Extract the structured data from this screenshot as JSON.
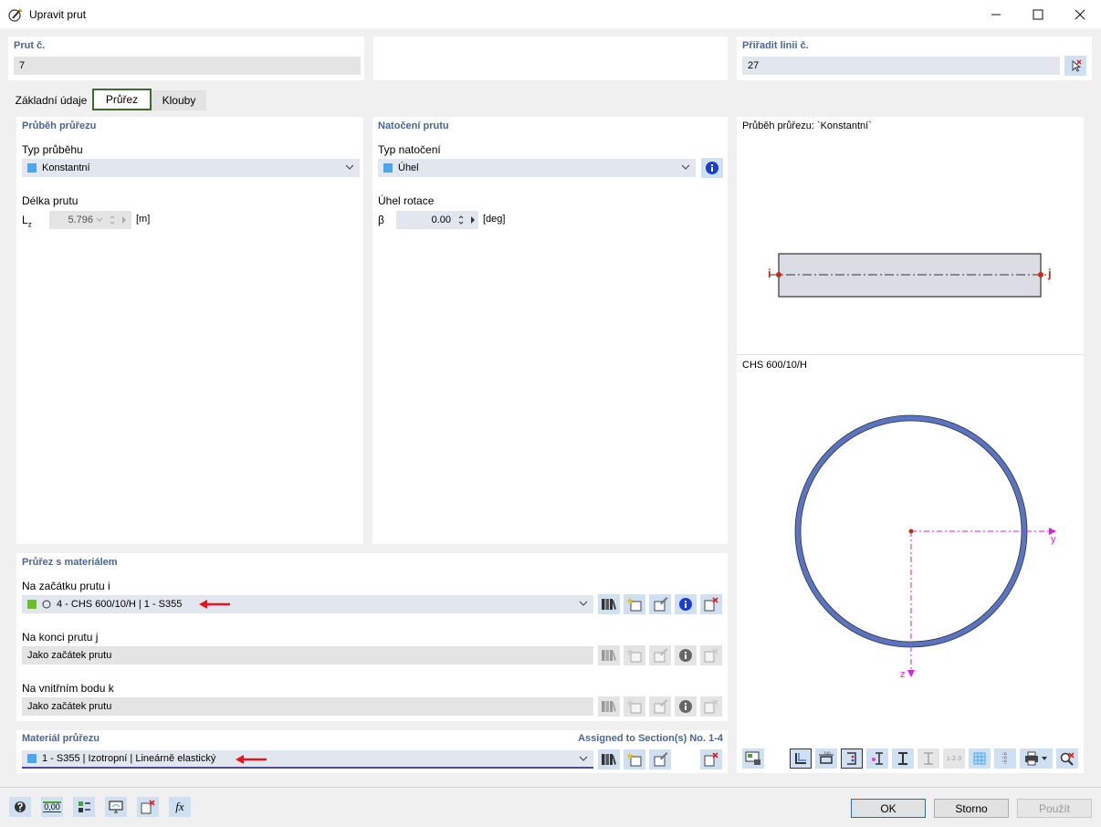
{
  "window": {
    "title": "Upravit prut"
  },
  "header": {
    "member_label": "Prut č.",
    "member_value": "7",
    "line_label": "Přiřadit linii č.",
    "line_value": "27"
  },
  "tabs": [
    {
      "label": "Základní údaje"
    },
    {
      "label": "Průřez"
    },
    {
      "label": "Klouby"
    }
  ],
  "section_variation": {
    "title": "Průběh průřezu",
    "type_label": "Typ průběhu",
    "type_value": "Konstantní",
    "length_label": "Délka prutu",
    "length_symbol": "L",
    "length_subscript": "z",
    "length_value": "5.796",
    "length_unit": "[m]"
  },
  "rotation": {
    "title": "Natočení prutu",
    "type_label": "Typ natočení",
    "type_value": "Úhel",
    "angle_label": "Úhel rotace",
    "angle_symbol": "β",
    "angle_value": "0.00",
    "angle_unit": "[deg]"
  },
  "section_material": {
    "title": "Průřez s materiálem",
    "start_label": "Na začátku prutu i",
    "start_value": "4 - CHS 600/10/H | 1 - S355",
    "end_label": "Na konci prutu j",
    "end_value": "Jako začátek prutu",
    "inner_label": "Na vnitřním bodu k",
    "inner_value": "Jako začátek prutu"
  },
  "material": {
    "title": "Materiál průřezu",
    "assigned": "Assigned to Section(s) No. 1-4",
    "value": "1 - S355 | Izotropní | Lineárně elastický"
  },
  "preview": {
    "variation_title": "Průběh průřezu: `Konstantní`",
    "node_i": "i",
    "node_j": "j",
    "section_name": "CHS 600/10/H",
    "axis_y": "y",
    "axis_z": "z",
    "toolbar_extra": "1·2·3"
  },
  "buttons": {
    "ok": "OK",
    "cancel": "Storno",
    "apply": "Použít",
    "fx": "fx",
    "zero": "0,00"
  },
  "colors": {
    "accent": "#4a6596",
    "section_green": "#6cbf2a",
    "blue_square": "#4ea6ea",
    "arrow_red": "#e8141b",
    "axis_magenta": "#e01ee0",
    "tube_blue": "#5a74c4"
  }
}
